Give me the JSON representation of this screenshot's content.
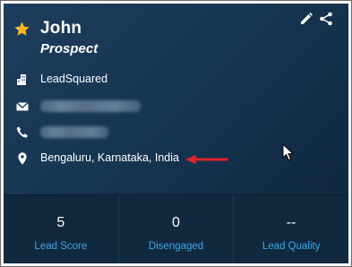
{
  "lead": {
    "name": "John",
    "stage": "Prospect",
    "company": "LeadSquared",
    "email": "",
    "phone": "",
    "location": "Bengaluru, Karnataka, India"
  },
  "icons": {
    "favorite": "star-icon",
    "edit": "pencil-icon",
    "share": "share-icon",
    "company": "building-icon",
    "email": "envelope-icon",
    "phone": "phone-icon",
    "location": "map-pin-icon"
  },
  "stats": [
    {
      "value": "5",
      "label": "Lead Score"
    },
    {
      "value": "0",
      "label": "Disengaged"
    },
    {
      "value": "--",
      "label": "Lead Quality"
    }
  ],
  "colors": {
    "card_background": "#163551",
    "star": "#f4b623",
    "stat_label": "#3fa8e8",
    "annotation_arrow": "#e0202a"
  }
}
